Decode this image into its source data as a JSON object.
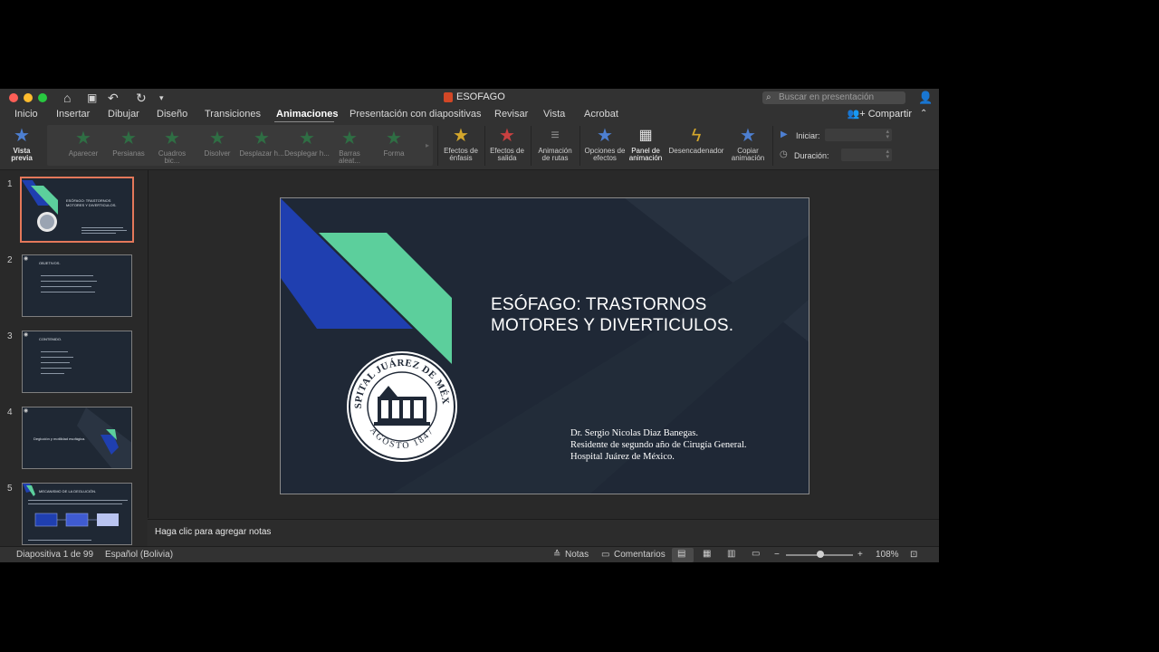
{
  "window": {
    "title": "ESOFAGO"
  },
  "search": {
    "placeholder": "Buscar en presentación"
  },
  "menu": {
    "tabs": [
      "Inicio",
      "Insertar",
      "Dibujar",
      "Diseño",
      "Transiciones",
      "Animaciones",
      "Presentación con diapositivas",
      "Revisar",
      "Vista",
      "Acrobat"
    ],
    "active_tab": "Animaciones",
    "share": "Compartir"
  },
  "ribbon": {
    "preview": "Vista previa",
    "gallery": [
      "Aparecer",
      "Persianas",
      "Cuadros bic...",
      "Disolver",
      "Desplazar h...",
      "Desplegar h...",
      "Barras aleat...",
      "Forma"
    ],
    "effects_emphasis": "Efectos de énfasis",
    "effects_exit": "Efectos de salida",
    "path_animation": "Animación de rutas",
    "effect_options": "Opciones de efectos",
    "animation_pane": "Panel de animación",
    "trigger": "Desencadenador",
    "copy_animation": "Copiar animación",
    "start_label": "Iniciar:",
    "duration_label": "Duración:"
  },
  "thumbnails": [
    {
      "num": "1",
      "title": "ESÓFAGO: TRASTORNOS MOTORES Y DIVERTICULOS."
    },
    {
      "num": "2",
      "title": "OBJETIVOS."
    },
    {
      "num": "3",
      "title": "CONTENIDO."
    },
    {
      "num": "4",
      "title": "Deglución y motilidad esofágica."
    },
    {
      "num": "5",
      "title": "MECANISMO DE LA DEGLUCIÓN."
    }
  ],
  "slide": {
    "title": "ESÓFAGO: TRASTORNOS\nMOTORES Y DIVERTICULOS.",
    "presenter": [
      "Dr. Sergio Nicolas Diaz Banegas.",
      "Residente de segundo año de Cirugía General.",
      "Hospital Juárez de México."
    ],
    "seal_top": "HOSPITAL JUÁREZ DE MÉXICO",
    "seal_bottom": "AGOSTO 1847"
  },
  "notes": {
    "placeholder": "Haga clic para agregar notas"
  },
  "status": {
    "slide_counter": "Diapositiva 1 de 99",
    "language": "Español (Bolivia)",
    "notes": "Notas",
    "comments": "Comentarios",
    "zoom": "108%"
  },
  "colors": {
    "slide_bg": "#1f2836",
    "accent_blue": "#1f3fb0",
    "accent_green": "#5ccf9c",
    "selection": "#e4785a"
  }
}
